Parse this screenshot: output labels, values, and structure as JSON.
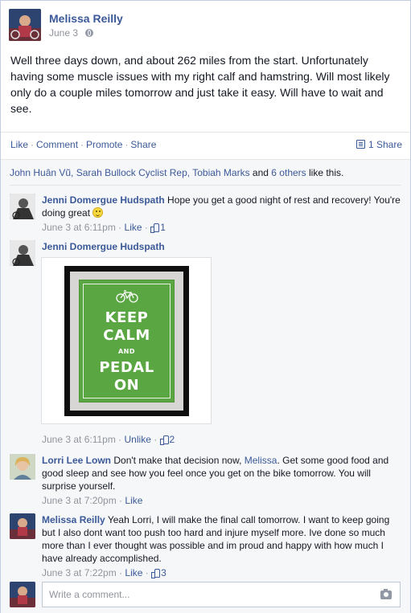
{
  "post": {
    "author": "Melissa Reilly",
    "date": "June 3",
    "privacy_icon": "globe-icon",
    "body": "Well three days down, and about 262 miles from the start. Unfortunately having some muscle issues with my right calf and hamstring. Will most likely only do a couple miles tomorrow and just take it easy. Will have to wait and see."
  },
  "actions": {
    "like": "Like",
    "comment": "Comment",
    "promote": "Promote",
    "share": "Share",
    "share_count": "1 Share"
  },
  "likes": {
    "names": "John Huân Vũ, Sarah Bullock Cyclist Rep, Tobiah Marks",
    "connector": " and ",
    "others": "6 others",
    "suffix": " like this."
  },
  "comments": [
    {
      "name": "Jenni Domergue Hudspath",
      "text": "Hope you get a good night of rest and recovery! You're doing great",
      "time": "June 3 at 6:11pm",
      "action": "Like",
      "likes": "1"
    },
    {
      "name": "Jenni Domergue Hudspath",
      "text": "",
      "image_lines": [
        "KEEP",
        "CALM",
        "AND",
        "PEDAL",
        "ON"
      ],
      "time": "June 3 at 6:11pm",
      "action": "Unlike",
      "likes": "2"
    },
    {
      "name": "Lorri Lee Lown",
      "text_before": "Don't make that decision now, ",
      "mention": "Melissa",
      "text_after": ". Get some good food and good sleep and see how you feel once you get on the bike tomorrow. You will surprise yourself.",
      "time": "June 3 at 7:20pm",
      "action": "Like"
    },
    {
      "name": "Melissa Reilly",
      "text": "Yeah Lorri, I will make the final call tomorrow. I want to keep going but I also dont want too push too hard and injure myself more. Ive done so much more than I ever thought was possible and im proud and happy with how much I have already accomplished.",
      "time": "June 3 at 7:22pm",
      "action": "Like",
      "likes": "3"
    }
  ],
  "composer": {
    "placeholder": "Write a comment...",
    "camera_icon": "camera-icon"
  },
  "colors": {
    "link": "#3b5998",
    "meta": "#90949c",
    "ufi_bg": "#f6f7f9",
    "poster_green": "#5aa642"
  }
}
